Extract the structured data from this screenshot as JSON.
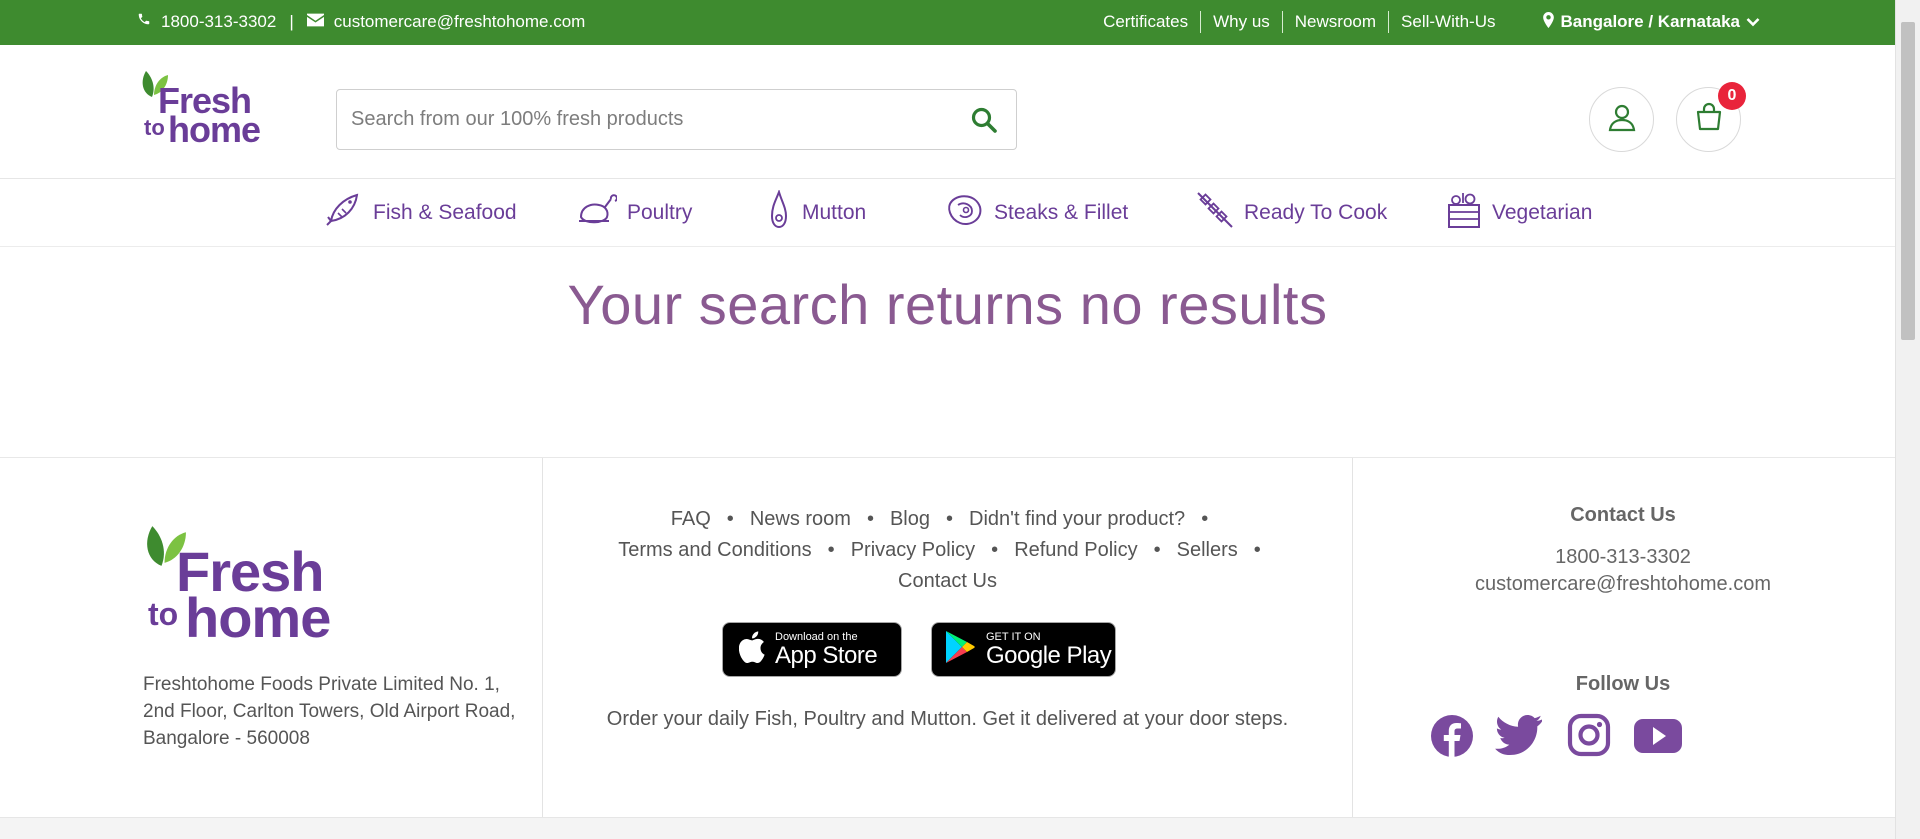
{
  "topbar": {
    "phone": "1800-313-3302",
    "separator": "|",
    "email": "customercare@freshtohome.com",
    "links": [
      "Certificates",
      "Why us",
      "Newsroom",
      "Sell-With-Us"
    ],
    "location": "Bangalore / Karnataka",
    "bg_color": "#3e8b2f"
  },
  "header": {
    "logo": {
      "fresh": "Fresh",
      "to": "to",
      "home": "home"
    },
    "search": {
      "placeholder": "Search from our 100% fresh products",
      "value": ""
    },
    "cart_count": "0"
  },
  "nav": {
    "items": [
      {
        "label": "Fish & Seafood",
        "icon": "fish-icon"
      },
      {
        "label": "Poultry",
        "icon": "poultry-icon"
      },
      {
        "label": "Mutton",
        "icon": "mutton-icon"
      },
      {
        "label": "Steaks & Fillet",
        "icon": "steak-icon"
      },
      {
        "label": "Ready To Cook",
        "icon": "skewer-icon"
      },
      {
        "label": "Vegetarian",
        "icon": "vegetable-basket-icon"
      }
    ]
  },
  "main": {
    "message": "Your search returns no results"
  },
  "footer": {
    "logo": {
      "fresh": "Fresh",
      "to": "to",
      "home": "home"
    },
    "address": "Freshtohome Foods Private Limited No. 1, 2nd Floor, Carlton Towers, Old Airport Road, Bangalore - 560008",
    "links": [
      "FAQ",
      "News room",
      "Blog",
      "Didn't find your product?",
      "Terms and Conditions",
      "Privacy Policy",
      "Refund Policy",
      "Sellers",
      "Contact Us"
    ],
    "app_store": {
      "small": "Download on the",
      "big": "App Store"
    },
    "google_play": {
      "small": "GET IT ON",
      "big": "Google Play"
    },
    "tagline": "Order your daily Fish, Poultry and Mutton. Get it delivered at your door steps.",
    "contact": {
      "title": "Contact Us",
      "phone": "1800-313-3302",
      "email": "customercare@freshtohome.com"
    },
    "follow": {
      "title": "Follow Us",
      "networks": [
        "facebook-icon",
        "twitter-icon",
        "instagram-icon",
        "youtube-icon"
      ]
    }
  },
  "colors": {
    "brand_purple": "#6a3d98",
    "brand_green": "#3e8b2f",
    "message_color": "#8a5a91",
    "badge_red": "#e9243b"
  }
}
